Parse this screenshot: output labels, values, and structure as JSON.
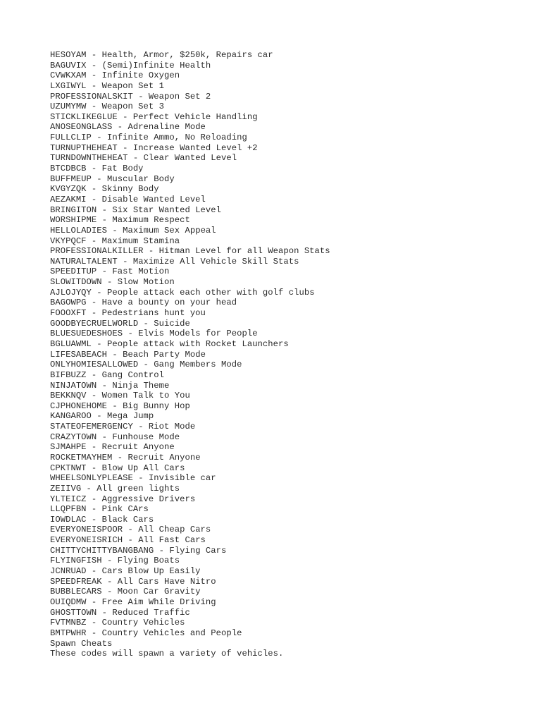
{
  "cheats": [
    {
      "code": "HESOYAM",
      "effect": "Health, Armor, $250k, Repairs car"
    },
    {
      "code": "BAGUVIX",
      "effect": "(Semi)Infinite Health"
    },
    {
      "code": "CVWKXAM",
      "effect": "Infinite Oxygen"
    },
    {
      "code": "LXGIWYL",
      "effect": "Weapon Set 1"
    },
    {
      "code": "PROFESSIONALSKIT",
      "effect": "Weapon Set 2"
    },
    {
      "code": "UZUMYMW",
      "effect": "Weapon Set 3"
    },
    {
      "code": "STICKLIKEGLUE",
      "effect": "Perfect Vehicle Handling"
    },
    {
      "code": "ANOSEONGLASS",
      "effect": "Adrenaline Mode"
    },
    {
      "code": "FULLCLIP",
      "effect": "Infinite Ammo, No Reloading"
    },
    {
      "code": "TURNUPTHEHEAT",
      "effect": "Increase Wanted Level +2"
    },
    {
      "code": "TURNDOWNTHEHEAT",
      "effect": "Clear Wanted Level"
    },
    {
      "code": "BTCDBCB",
      "effect": "Fat Body"
    },
    {
      "code": "BUFFMEUP",
      "effect": "Muscular Body"
    },
    {
      "code": "KVGYZQK",
      "effect": "Skinny Body"
    },
    {
      "code": "AEZAKMI",
      "effect": "Disable Wanted Level"
    },
    {
      "code": "BRINGITON",
      "effect": "Six Star Wanted Level"
    },
    {
      "code": "WORSHIPME",
      "effect": "Maximum Respect"
    },
    {
      "code": "HELLOLADIES",
      "effect": "Maximum Sex Appeal"
    },
    {
      "code": "VKYPQCF",
      "effect": "Maximum Stamina"
    },
    {
      "code": "PROFESSIONALKILLER",
      "effect": "Hitman Level for all Weapon Stats"
    },
    {
      "code": "NATURALTALENT",
      "effect": "Maximize All Vehicle Skill Stats"
    },
    {
      "code": "SPEEDITUP",
      "effect": "Fast Motion"
    },
    {
      "code": "SLOWITDOWN",
      "effect": "Slow Motion"
    },
    {
      "code": "AJLOJYQY",
      "effect": "People attack each other with golf clubs"
    },
    {
      "code": "BAGOWPG",
      "effect": "Have a bounty on your head"
    },
    {
      "code": "FOOOXFT",
      "effect": "Pedestrians hunt you"
    },
    {
      "code": "GOODBYECRUELWORLD",
      "effect": "Suicide"
    },
    {
      "code": "BLUESUEDESHOES",
      "effect": "Elvis Models for People"
    },
    {
      "code": "BGLUAWML",
      "effect": "People attack with Rocket Launchers"
    },
    {
      "code": "LIFESABEACH",
      "effect": "Beach Party Mode"
    },
    {
      "code": "ONLYHOMIESALLOWED",
      "effect": "Gang Members Mode"
    },
    {
      "code": "BIFBUZZ",
      "effect": "Gang Control"
    },
    {
      "code": "NINJATOWN",
      "effect": "Ninja Theme"
    },
    {
      "code": "BEKKNQV",
      "effect": "Women Talk to You"
    },
    {
      "code": "CJPHONEHOME",
      "effect": "Big Bunny Hop"
    },
    {
      "code": "KANGAROO",
      "effect": "Mega Jump"
    },
    {
      "code": "STATEOFEMERGENCY",
      "effect": "Riot Mode"
    },
    {
      "code": "CRAZYTOWN",
      "effect": "Funhouse Mode"
    },
    {
      "code": "SJMAHPE",
      "effect": "Recruit Anyone"
    },
    {
      "code": "ROCKETMAYHEM",
      "effect": "Recruit Anyone"
    },
    {
      "code": "CPKTNWT",
      "effect": "Blow Up All Cars"
    },
    {
      "code": "WHEELSONLYPLEASE",
      "effect": "Invisible car"
    },
    {
      "code": "ZEIIVG",
      "effect": "All green lights"
    },
    {
      "code": "YLTEICZ",
      "effect": "Aggressive Drivers"
    },
    {
      "code": "LLQPFBN",
      "effect": "Pink CArs"
    },
    {
      "code": "IOWDLAC",
      "effect": "Black Cars"
    },
    {
      "code": "EVERYONEISPOOR",
      "effect": "All Cheap Cars"
    },
    {
      "code": "EVERYONEISRICH",
      "effect": "All Fast Cars"
    },
    {
      "code": "CHITTYCHITTYBANGBANG",
      "effect": "Flying Cars"
    },
    {
      "code": "FLYINGFISH",
      "effect": "Flying Boats"
    },
    {
      "code": "JCNRUAD",
      "effect": "Cars Blow Up Easily"
    },
    {
      "code": "SPEEDFREAK",
      "effect": "All Cars Have Nitro"
    },
    {
      "code": "BUBBLECARS",
      "effect": "Moon Car Gravity"
    },
    {
      "code": "OUIQDMW",
      "effect": "Free Aim While Driving"
    },
    {
      "code": "GHOSTTOWN",
      "effect": "Reduced Traffic"
    },
    {
      "code": "FVTMNBZ",
      "effect": "Country Vehicles"
    },
    {
      "code": "BMTPWHR",
      "effect": "Country Vehicles and People"
    }
  ],
  "separator": " - ",
  "section": {
    "heading": "Spawn Cheats",
    "intro": "These codes will spawn a variety of vehicles."
  }
}
